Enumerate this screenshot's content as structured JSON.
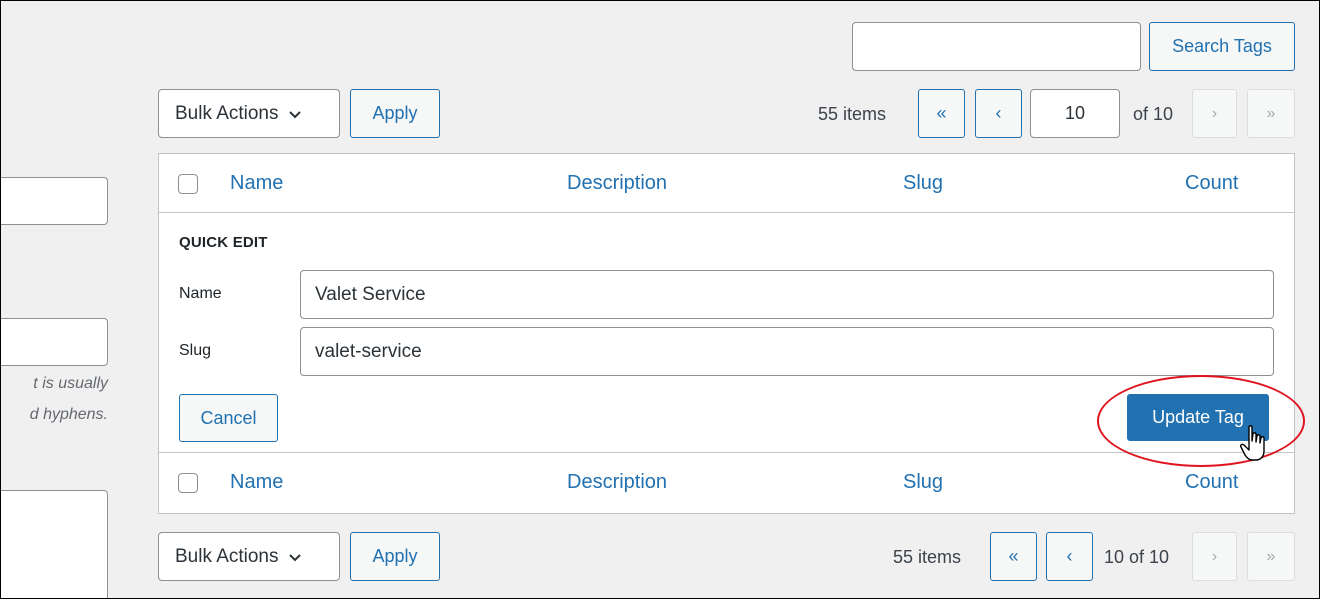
{
  "search": {
    "value": "",
    "button_label": "Search Tags"
  },
  "top_nav": {
    "bulk_actions_label": "Bulk Actions",
    "apply_label": "Apply",
    "items_count": "55 items",
    "first_page_glyph": "«",
    "prev_page_glyph": "‹",
    "current_page": "10",
    "of_pages": "of 10",
    "next_page_glyph": "›",
    "last_page_glyph": "»"
  },
  "table": {
    "columns": [
      "Name",
      "Description",
      "Slug",
      "Count"
    ]
  },
  "quick_edit": {
    "title": "QUICK EDIT",
    "name_label": "Name",
    "name_value": "Valet Service",
    "slug_label": "Slug",
    "slug_value": "valet-service",
    "cancel_label": "Cancel",
    "update_label": "Update Tag"
  },
  "bottom_nav": {
    "bulk_actions_label": "Bulk Actions",
    "apply_label": "Apply",
    "items_count": "55 items",
    "first_page_glyph": "«",
    "prev_page_glyph": "‹",
    "page_info": "10 of 10",
    "next_page_glyph": "›",
    "last_page_glyph": "»"
  },
  "left_column": {
    "hint_line1": "t is usually",
    "hint_line2": "d hyphens."
  },
  "colors": {
    "accent": "#2271b1",
    "highlight_ring": "#e0141e",
    "background": "#f0f0f1"
  }
}
